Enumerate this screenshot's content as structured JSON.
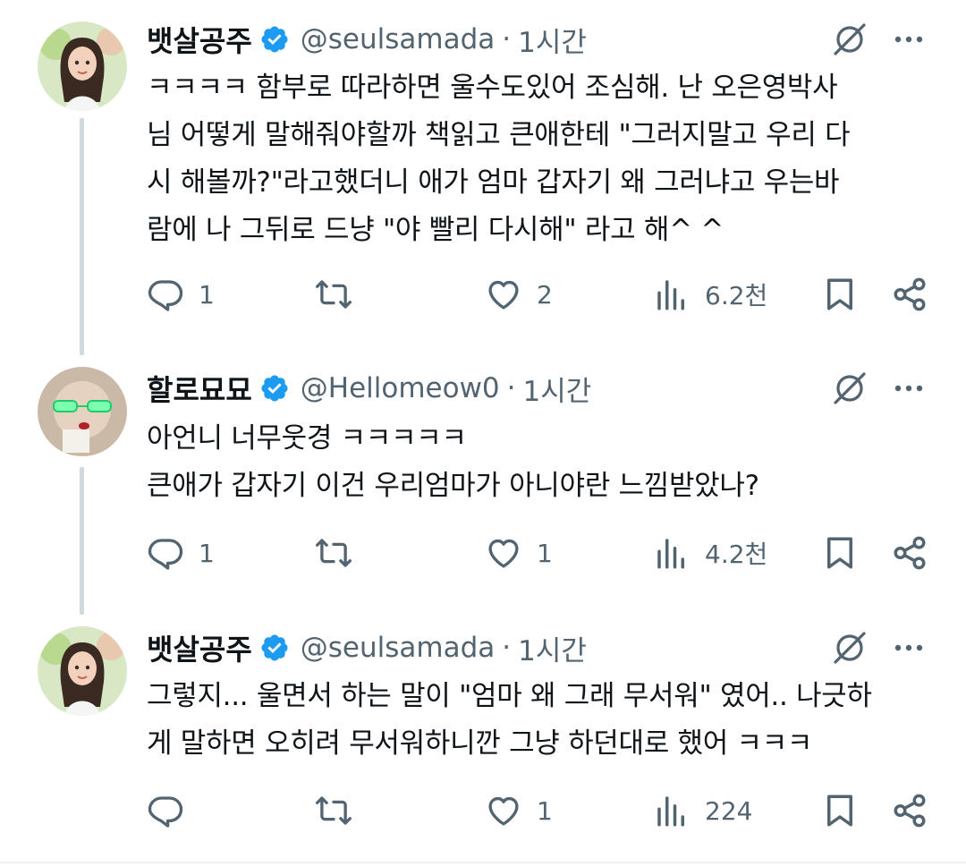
{
  "tweets": [
    {
      "name": "뱃살공주",
      "handle": "@seulsamada",
      "sep": "·",
      "time": "1시간",
      "text": "ㅋㅋㅋㅋ 함부로 따라하면 울수도있어 조심해. 난 오은영박사\n님 어떻게 말해줘야할까 책읽고 큰애한테 \"그러지말고 우리 다\n시 해볼까?\"라고했더니 애가 엄마 갑자기 왜 그러냐고 우는바\n람에 나 그뒤로 드냥 \"야 빨리 다시해\" 라고 해^ ^",
      "replies": "1",
      "retweets": "",
      "likes": "2",
      "views": "6.2천"
    },
    {
      "name": "할로묘묘",
      "handle": "@Hellomeow0",
      "sep": "·",
      "time": "1시간",
      "text": "아언니 너무웃경 ㅋㅋㅋㅋㅋ\n큰애가 갑자기 이건 우리엄마가 아니야란 느낌받았나?",
      "replies": "1",
      "retweets": "",
      "likes": "1",
      "views": "4.2천"
    },
    {
      "name": "뱃살공주",
      "handle": "@seulsamada",
      "sep": "·",
      "time": "1시간",
      "text": "그렇지... 울면서 하는 말이 \"엄마 왜 그래 무서워\" 였어.. 나긋하\n게 말하면 오히려 무서워하니깐 그냥 하던대로 했어 ㅋㅋㅋ",
      "replies": "",
      "retweets": "",
      "likes": "1",
      "views": "224"
    }
  ],
  "colors": {
    "verified": "#1d9bf0",
    "muted": "#536471",
    "text": "#0f1419",
    "thread_line": "#cfd9de"
  },
  "icons": [
    "reply-icon",
    "retweet-icon",
    "like-icon",
    "views-icon",
    "bookmark-icon",
    "share-icon",
    "grok-icon",
    "more-icon",
    "verified-badge-icon"
  ]
}
